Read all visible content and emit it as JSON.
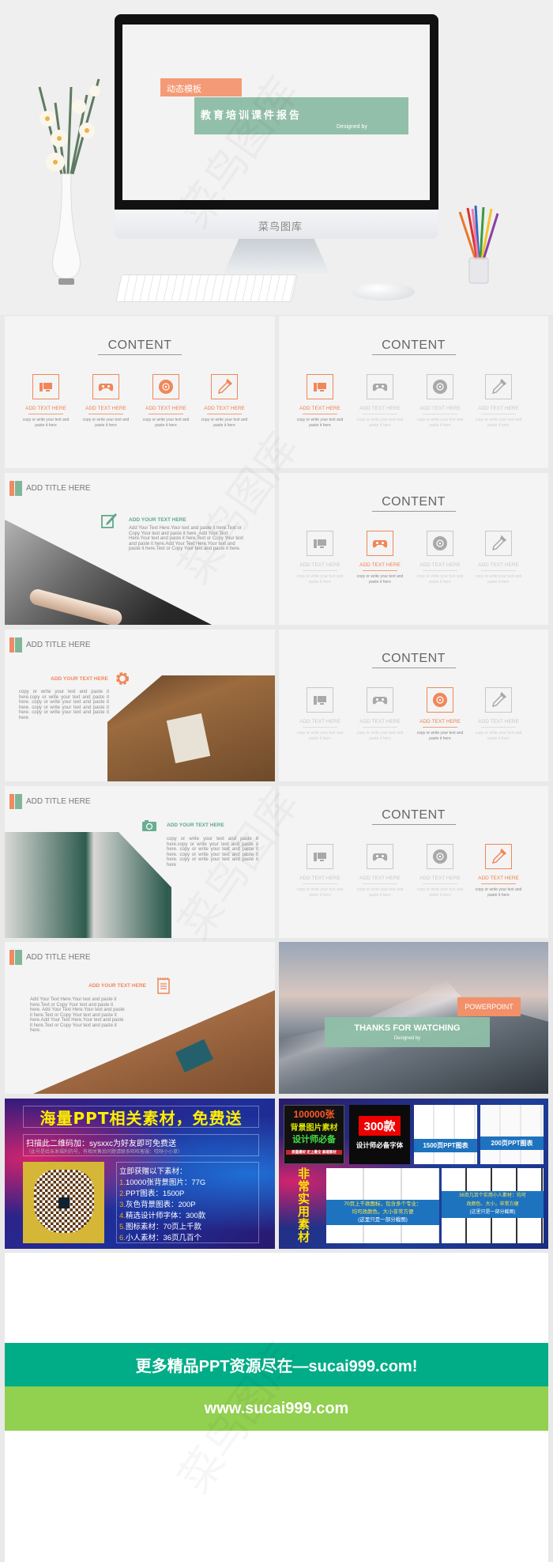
{
  "colors": {
    "accent_orange": "#f0875a",
    "accent_green": "#8fbfa8",
    "teal_text": "#5fa88a",
    "banner_green": "#00ad87",
    "banner_lime": "#92d050"
  },
  "watermark": "菜鸟图库",
  "hero": {
    "tag": "动态模板",
    "title": "教育培训课件报告",
    "designed_by": "Designed by",
    "monitor_brand": "菜鸟图库"
  },
  "content_slides": [
    {
      "title": "CONTENT",
      "active": [
        0,
        1,
        2,
        3
      ],
      "items": [
        {
          "label": "ADD TEXT HERE",
          "desc": "copy or write your text and paste it here",
          "icon": "computer-icon"
        },
        {
          "label": "ADD TEXT HERE",
          "desc": "copy or write your text and paste it here",
          "icon": "gamepad-icon"
        },
        {
          "label": "ADD TEXT HERE",
          "desc": "copy or write your text and paste it here",
          "icon": "disc-icon"
        },
        {
          "label": "ADD TEXT HERE",
          "desc": "copy or write your text and paste it here",
          "icon": "dropper-icon"
        }
      ]
    },
    {
      "title": "CONTENT",
      "active": [
        0
      ],
      "items": [
        {
          "label": "ADD TEXT HERE",
          "desc": "copy or write your text and paste it here",
          "icon": "computer-icon"
        },
        {
          "label": "ADD TEXT HERE",
          "desc": "copy or write your text and paste it here",
          "icon": "gamepad-icon"
        },
        {
          "label": "ADD TEXT HERE",
          "desc": "copy or write your text and paste it here",
          "icon": "disc-icon"
        },
        {
          "label": "ADD TEXT HERE",
          "desc": "copy or write your text and paste it here",
          "icon": "dropper-icon"
        }
      ]
    },
    {
      "title": "CONTENT",
      "active": [
        1
      ],
      "items": [
        {
          "label": "ADD TEXT HERE",
          "desc": "copy or write your text and paste it here",
          "icon": "computer-icon"
        },
        {
          "label": "ADD TEXT HERE",
          "desc": "copy or write your text and paste it here",
          "icon": "gamepad-icon"
        },
        {
          "label": "ADD TEXT HERE",
          "desc": "copy or write your text and paste it here",
          "icon": "disc-icon"
        },
        {
          "label": "ADD TEXT HERE",
          "desc": "copy or write your text and paste it here",
          "icon": "dropper-icon"
        }
      ]
    },
    {
      "title": "CONTENT",
      "active": [
        2
      ],
      "items": [
        {
          "label": "ADD TEXT HERE",
          "desc": "copy or write your text and paste it here",
          "icon": "computer-icon"
        },
        {
          "label": "ADD TEXT HERE",
          "desc": "copy or write your text and paste it here",
          "icon": "gamepad-icon"
        },
        {
          "label": "ADD TEXT HERE",
          "desc": "copy or write your text and paste it here",
          "icon": "disc-icon"
        },
        {
          "label": "ADD TEXT HERE",
          "desc": "copy or write your text and paste it here",
          "icon": "dropper-icon"
        }
      ]
    },
    {
      "title": "CONTENT",
      "active": [
        3
      ],
      "items": [
        {
          "label": "ADD TEXT HERE",
          "desc": "copy or write your text and paste it here",
          "icon": "computer-icon"
        },
        {
          "label": "ADD TEXT HERE",
          "desc": "copy or write your text and paste it here",
          "icon": "gamepad-icon"
        },
        {
          "label": "ADD TEXT HERE",
          "desc": "copy or write your text and paste it here",
          "icon": "disc-icon"
        },
        {
          "label": "ADD TEXT HERE",
          "desc": "copy or write your text and paste it here",
          "icon": "dropper-icon"
        }
      ]
    }
  ],
  "title_slides": [
    {
      "title": "ADD TITLE HERE",
      "heading": "ADD YOUR TEXT HERE",
      "icon": "pen-icon",
      "body": "Add Your Text Here.Your text and paste it here.Text or Copy Your text and paste it here. Add Your Text Here.Your text and paste it here.Text or Copy Your text and paste it here.Add Your Text Here.Your text and paste it here.Text or Copy Your text and paste it here."
    },
    {
      "title": "ADD TITLE HERE",
      "heading": "ADD YOUR TEXT HERE",
      "icon": "gear-icon",
      "body": "copy or write your text and paste it here.copy or write your text and paste it here. copy or write your text and paste it here. copy or write your text and paste it here. copy or write your text and paste it here"
    },
    {
      "title": "ADD TITLE HERE",
      "heading": "ADD YOUR TEXT HERE",
      "icon": "camera-icon",
      "body": "copy or write your text and paste it here.copy or write your text and paste it here. copy or write your text and paste it here. copy or write your text and paste it here. copy or write your text and paste it here"
    },
    {
      "title": "ADD TITLE HERE",
      "heading": "ADD YOUR TEXT HERE",
      "icon": "notepad-icon",
      "body": "Add Your Text Here.Your text and paste it here.Text or Copy Your text and paste it here. Add Your Text Here.Your text and paste it here.Text or Copy Your text and paste it here.Add Your Text Here.Your text and paste it here.Text or Copy Your text and paste it here."
    }
  ],
  "thanks": {
    "tag": "POWERPOINT",
    "title": "THANKS FOR WATCHING",
    "designed_by": "Designed by"
  },
  "ad_left": {
    "title": "海量PPT相关素材，免费送",
    "scan": "扫描此二维码加：sysxxc为好友即可免费送",
    "note": "（此号是给亲发福利的号，有相关售后问题请联系旺旺客服：哎呀小小草）",
    "list_title": "立即获赠以下素材：",
    "list": [
      {
        "num": "1.",
        "text": "10000张背景图片：77G"
      },
      {
        "num": "2.",
        "text": "PPT图表：1500P"
      },
      {
        "num": "3.",
        "text": "灰色背景图表：200P"
      },
      {
        "num": "4.",
        "text": "精选设计师字体：300款"
      },
      {
        "num": "5.",
        "text": "图标素材：70页上千款"
      },
      {
        "num": "6.",
        "text": "小人素材：36页几百个"
      }
    ]
  },
  "ad_right": {
    "bg_count": "100000张",
    "bg_label": "背景图片素材",
    "bg_sub": "设计师必备",
    "bg_tags": "质量最好  史上最全  高端素材",
    "font_count": "300款",
    "font_label": "设计师必备字体",
    "charts1": "1500页PPT图表",
    "charts2": "200页PPT图表",
    "vertical": "非常实用素材",
    "icons_caption": [
      "70页上千款图标，包含多个专业：",
      "均可改颜色，大小非常方便",
      "(这里只是一部分截图)"
    ],
    "people_caption": [
      "36页几百个实用小人素材：均可",
      "改颜色、大小，非常方便",
      "(这里只是一部分截图)"
    ]
  },
  "footer": {
    "banner1": "更多精品PPT资源尽在—sucai999.com!",
    "banner2": "www.sucai999.com"
  }
}
